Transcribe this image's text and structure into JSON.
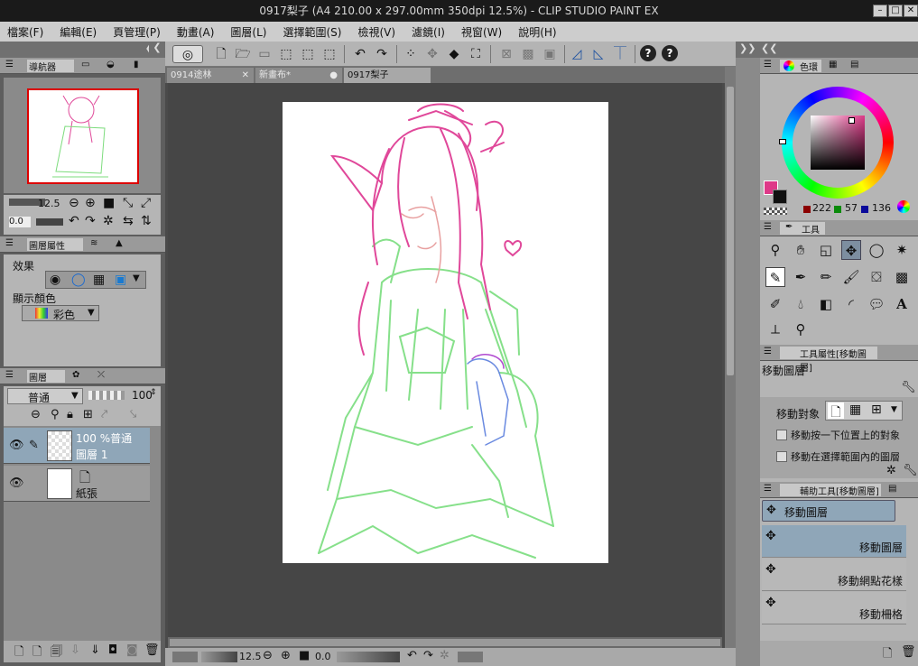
{
  "title": "0917梨子 (A4 210.00 x 297.00mm 350dpi 12.5%) - CLIP STUDIO PAINT EX",
  "menu": [
    "檔案(F)",
    "編輯(E)",
    "頁管理(P)",
    "動畫(A)",
    "圖層(L)",
    "選擇範圍(S)",
    "檢視(V)",
    "濾鏡(I)",
    "視窗(W)",
    "說明(H)"
  ],
  "doc_tabs": [
    {
      "label": "0914途林",
      "close": "✕"
    },
    {
      "label": "新畫布*",
      "close": "●"
    },
    {
      "label": "0917梨子",
      "close": ""
    }
  ],
  "navigator": {
    "tab": "導航器",
    "zoom": "12.5",
    "angle": "0.0"
  },
  "layer_property": {
    "tab": "圖層屬性",
    "effect_label": "效果",
    "color_label": "顯示顏色",
    "color_value": "彩色"
  },
  "layers_panel": {
    "tab": "圖層",
    "blend": "普通",
    "opacity": "100",
    "layers": [
      {
        "line1": "100 %普通",
        "line2": "圖層 1"
      },
      {
        "line1": "",
        "line2": "紙張"
      }
    ]
  },
  "color_wheel": {
    "tab": "色環",
    "r": "222",
    "g": "57",
    "b": "136",
    "main_color": "#de3988",
    "sub_color": "#111111"
  },
  "tools": {
    "tab": "工具"
  },
  "tool_property": {
    "tab": "工具屬性[移動圖層]",
    "name": "移動圖層",
    "target_label": "移動對象",
    "opt1": "移動按一下位置上的對象",
    "opt2": "移動在選擇範圍內的圖層"
  },
  "sub_tool": {
    "tab": "輔助工具[移動圖層]",
    "current": "移動圖層",
    "items": [
      "移動圖層",
      "移動網點花樣",
      "移動柵格"
    ]
  },
  "bottom": {
    "zoom": "12.5",
    "angle": "0.0"
  }
}
